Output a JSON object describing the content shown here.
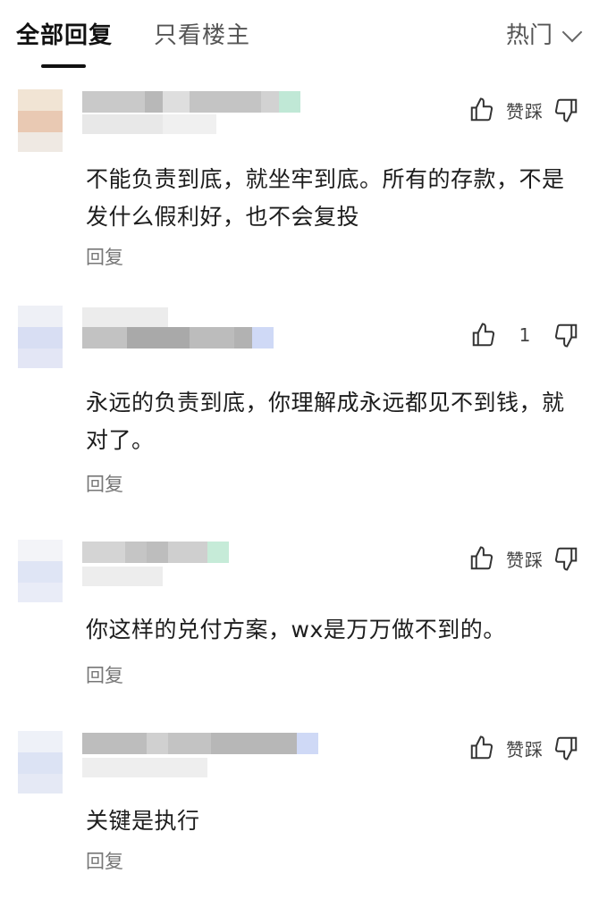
{
  "tabs": {
    "all": "全部回复",
    "op": "只看楼主"
  },
  "sort": {
    "label": "热门",
    "icon": "chevron-down-icon"
  },
  "comments": [
    {
      "text": "不能负责到底，就坐牢到底。所有的存款，不是发什么假利好，也不会复投",
      "votes": "赞踩",
      "reply": "回复",
      "avatar_colors": [
        "#f1e4d4",
        "#e9c9b3",
        "#efe9e3"
      ],
      "name_colors": [
        "#c9c9c9",
        "#b8b8b8",
        "#dedede",
        "#c4c4c4",
        "#d2d2d2",
        "#c0e8d6"
      ]
    },
    {
      "text": "永远的负责到底，你理解成永远都见不到钱，就对了。",
      "votes": "1",
      "reply": "回复",
      "avatar_colors": [
        "#eef0f6",
        "#d8def3",
        "#e3e6f5"
      ],
      "name_colors": [
        "#c2c2c2",
        "#a9a9a9",
        "#bcbcbc",
        "#b2b2b2",
        "#cfd9f6"
      ]
    },
    {
      "text": "你这样的兑付方案，wx是万万做不到的。",
      "votes": "赞踩",
      "reply": "回复",
      "avatar_colors": [
        "#f3f4f8",
        "#dfe5f5",
        "#e9ecf7"
      ],
      "name_colors": [
        "#d4d4d4",
        "#c5c5c5",
        "#bdbdbd",
        "#cfcfcf",
        "#c6ebd8"
      ]
    },
    {
      "text": "关键是执行",
      "votes": "赞踩",
      "reply": "回复",
      "avatar_colors": [
        "#eef1f8",
        "#dce3f4",
        "#e5e9f5"
      ],
      "name_colors": [
        "#bdbdbd",
        "#d0d0d0",
        "#c3c3c3",
        "#b7b7b7",
        "#cfd9f6"
      ]
    }
  ]
}
